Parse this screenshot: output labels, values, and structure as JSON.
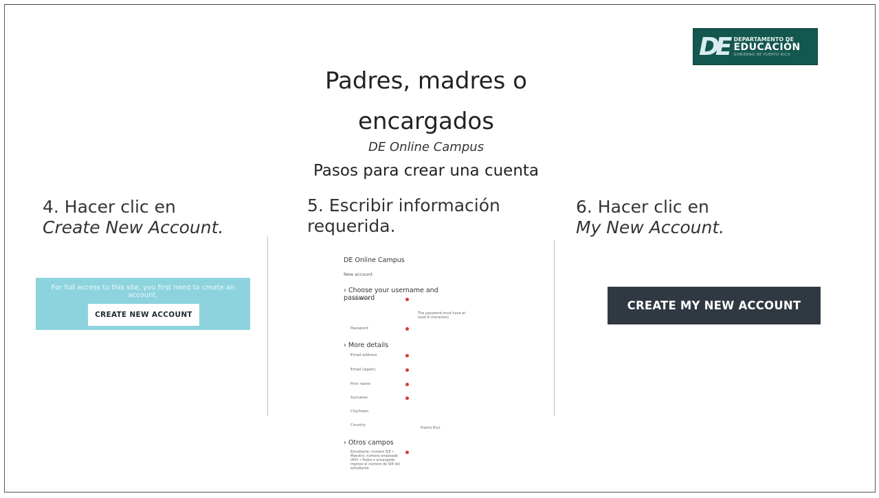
{
  "logo": {
    "initials": "DE",
    "line1": "DEPARTAMENTO DE",
    "line2": "EDUCACIÓN",
    "line3": "GOBIERNO DE PUERTO RICO"
  },
  "title": {
    "line1": "Padres, madres o",
    "line2": "encargados",
    "subtitle": "DE Online Campus",
    "subtitle2": "Pasos para crear una cuenta"
  },
  "steps": [
    {
      "line1": "4. Hacer clic en",
      "line2": "Create New Account."
    },
    {
      "line1": "5. Escribir información",
      "line2": "requerida."
    },
    {
      "line1": "6. Hacer clic en",
      "line2": "My New Account."
    }
  ],
  "panel4": {
    "text": "For full access to this site, you first need to create an account.",
    "button": "CREATE NEW ACCOUNT",
    "bg_color": "#8dd3de"
  },
  "form": {
    "site_name": "DE Online Campus",
    "page_label": "New account",
    "section1": "Choose your username and password",
    "username_label": "Username",
    "password_note": "The password must have at least 8 characters",
    "password_label": "Password",
    "section2": "More details",
    "email_label": "Email address",
    "email_again_label": "Email (again)",
    "firstname_label": "First name",
    "surname_label": "Surname",
    "city_label": "City/town",
    "country_label": "Country",
    "country_value": "Puerto Rico",
    "section3": "Otros campos",
    "other_field_label": "Estudiante: número SIE • Maestro: número empleado (RH) • Padre o encargado: ingrese el número de SIE del estudiante"
  },
  "panel6": {
    "button": "CREATE MY NEW ACCOUNT",
    "bg_color": "#303842"
  }
}
